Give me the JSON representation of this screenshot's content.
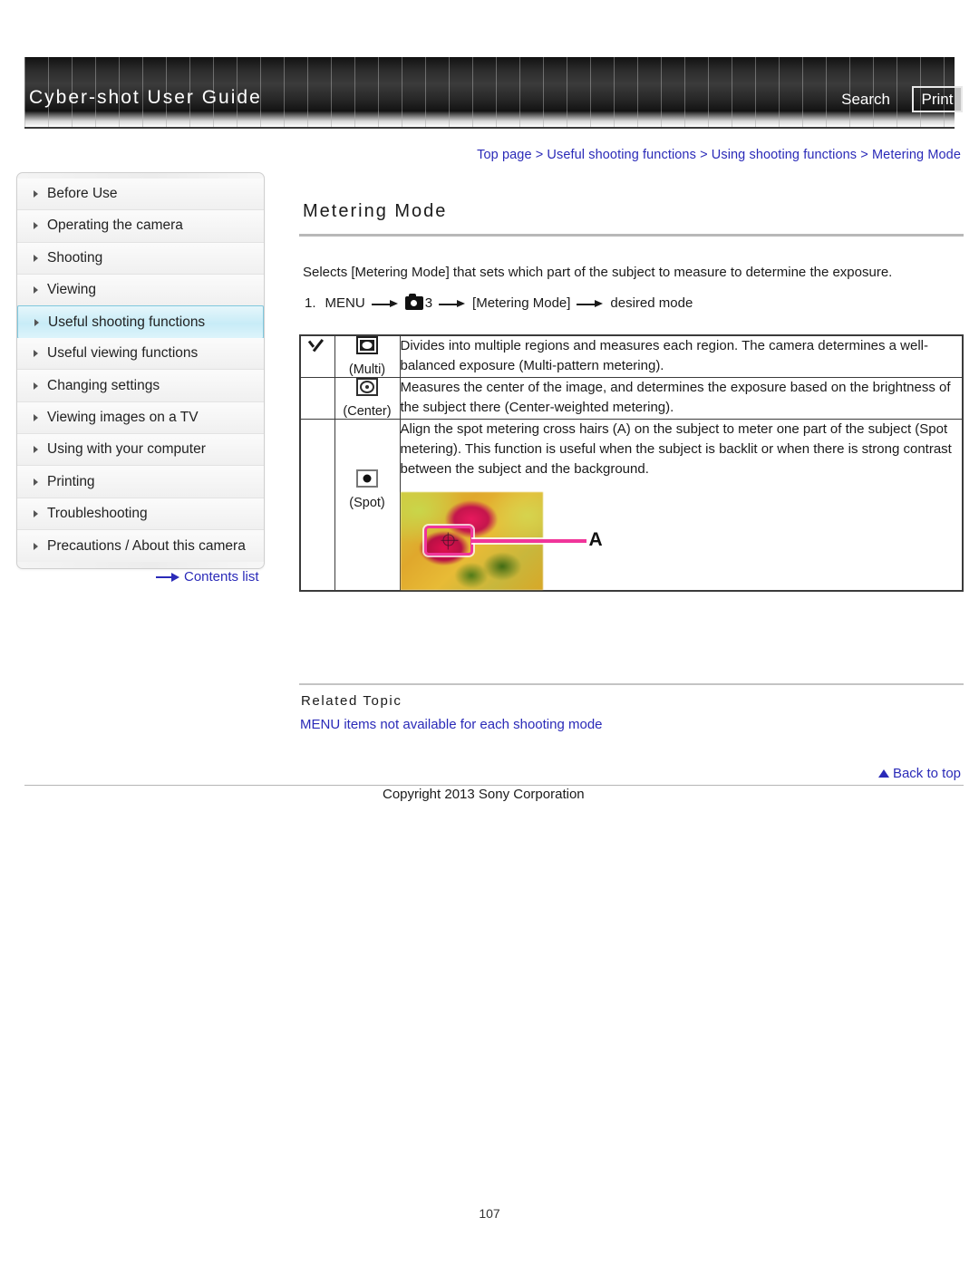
{
  "header": {
    "brand_title": "Cyber-shot User Guide",
    "search_label": "Search",
    "print_label": "Print"
  },
  "breadcrumb": {
    "text": "Top page > Useful shooting functions > Using shooting functions > Metering Mode"
  },
  "sidebar": {
    "items": [
      {
        "label": "Before Use",
        "active": false
      },
      {
        "label": "Operating the camera",
        "active": false
      },
      {
        "label": "Shooting",
        "active": false
      },
      {
        "label": "Viewing",
        "active": false
      },
      {
        "label": "Useful shooting functions",
        "active": true
      },
      {
        "label": "Useful viewing functions",
        "active": false
      },
      {
        "label": "Changing settings",
        "active": false
      },
      {
        "label": "Viewing images on a TV",
        "active": false
      },
      {
        "label": "Using with your computer",
        "active": false
      },
      {
        "label": "Printing",
        "active": false
      },
      {
        "label": "Troubleshooting",
        "active": false
      },
      {
        "label": "Precautions / About this camera",
        "active": false
      }
    ],
    "contents_list_label": "Contents list"
  },
  "main": {
    "page_title": "Metering Mode",
    "intro": "Selects [Metering Mode] that sets which part of the subject to measure to determine the exposure.",
    "step": {
      "number": "1.",
      "menu_label": "MENU",
      "menu_number": "3",
      "target": "[Metering Mode]",
      "result": "desired mode"
    },
    "table": {
      "rows": [
        {
          "checked": true,
          "icon_name": "metering-multi-icon",
          "icon_label": "(Multi)",
          "description": "Divides into multiple regions and measures each region. The camera determines a well-balanced exposure (Multi-pattern metering)."
        },
        {
          "checked": false,
          "icon_name": "metering-center-icon",
          "icon_label": "(Center)",
          "description": "Measures the center of the image, and determines the exposure based on the brightness of the subject there (Center-weighted metering)."
        },
        {
          "checked": false,
          "icon_name": "metering-spot-icon",
          "icon_label": "(Spot)",
          "description": "Align the spot metering cross hairs (A) on the subject to meter one part of the subject (Spot metering). This function is useful when the subject is backlit or when there is strong contrast between the subject and the background.",
          "photo_callout_label": "A"
        }
      ]
    },
    "related": {
      "heading": "Related Topic",
      "link": "MENU items not available for each shooting mode"
    }
  },
  "footer": {
    "back_to_top": "Back to top",
    "copyright": "Copyright 2013 Sony Corporation",
    "page_number": "107"
  },
  "colors": {
    "link": "#2a2ab8",
    "active_nav": "#c8ecf7",
    "callout_pink": "#f0359a"
  }
}
